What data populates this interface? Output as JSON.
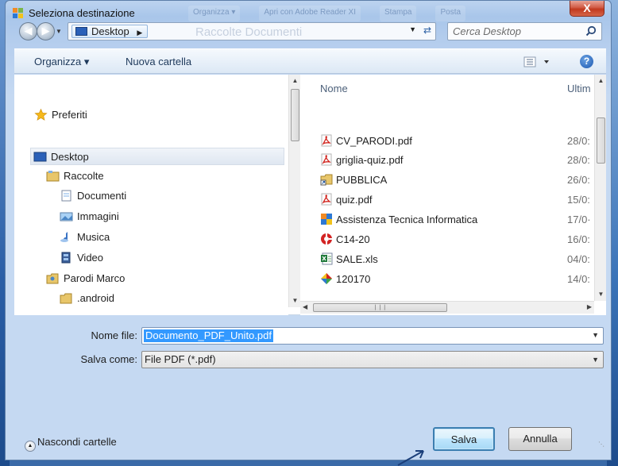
{
  "window": {
    "title": "Seleziona destinazione",
    "close_label": "X",
    "background_tabs": [
      "Organizza ▾",
      "Apri con Adobe Reader XI",
      "Stampa",
      "Posta"
    ]
  },
  "address": {
    "location": "Desktop",
    "ghost_text": "Raccolte Documenti",
    "search_placeholder": "Cerca Desktop"
  },
  "toolbar": {
    "organize_label": "Organizza ▾",
    "new_folder_label": "Nuova cartella",
    "help_label": "?"
  },
  "nav_pane": {
    "favorites_label": "Preferiti",
    "items": [
      {
        "label": "Desktop",
        "icon": "desktop-icon",
        "selected": true
      },
      {
        "label": "Raccolte",
        "icon": "libraries-icon"
      },
      {
        "label": "Documenti",
        "icon": "documents-icon"
      },
      {
        "label": "Immagini",
        "icon": "pictures-icon"
      },
      {
        "label": "Musica",
        "icon": "music-icon"
      },
      {
        "label": "Video",
        "icon": "video-icon"
      },
      {
        "label": "Parodi Marco",
        "icon": "user-folder-icon"
      },
      {
        "label": ".android",
        "icon": "folder-icon"
      }
    ]
  },
  "file_list": {
    "columns": [
      "Nome",
      "Ultim"
    ],
    "rows": [
      {
        "name": "CV_PARODI.pdf",
        "date": "28/0:",
        "icon": "pdf-icon"
      },
      {
        "name": "griglia-quiz.pdf",
        "date": "28/0:",
        "icon": "pdf-icon"
      },
      {
        "name": "PUBBLICA",
        "date": "26/0:",
        "icon": "folder-shortcut-icon"
      },
      {
        "name": "quiz.pdf",
        "date": "15/0:",
        "icon": "pdf-icon"
      },
      {
        "name": "Assistenza Tecnica Informatica",
        "date": "17/0·",
        "icon": "app-shortcut-icon"
      },
      {
        "name": "C14-20",
        "date": "16/0:",
        "icon": "red-app-icon"
      },
      {
        "name": "SALE.xls",
        "date": "04/0:",
        "icon": "excel-icon"
      },
      {
        "name": "120170",
        "date": "14/0:",
        "icon": "colorful-app-icon"
      }
    ]
  },
  "form": {
    "filename_label": "Nome file:",
    "filename_value": "Documento_PDF_Unito.pdf",
    "savetype_label": "Salva come:",
    "savetype_value": "File PDF (*.pdf)"
  },
  "footer": {
    "hide_folders_label": "Nascondi cartelle",
    "save_label": "Salva",
    "cancel_label": "Annulla"
  }
}
